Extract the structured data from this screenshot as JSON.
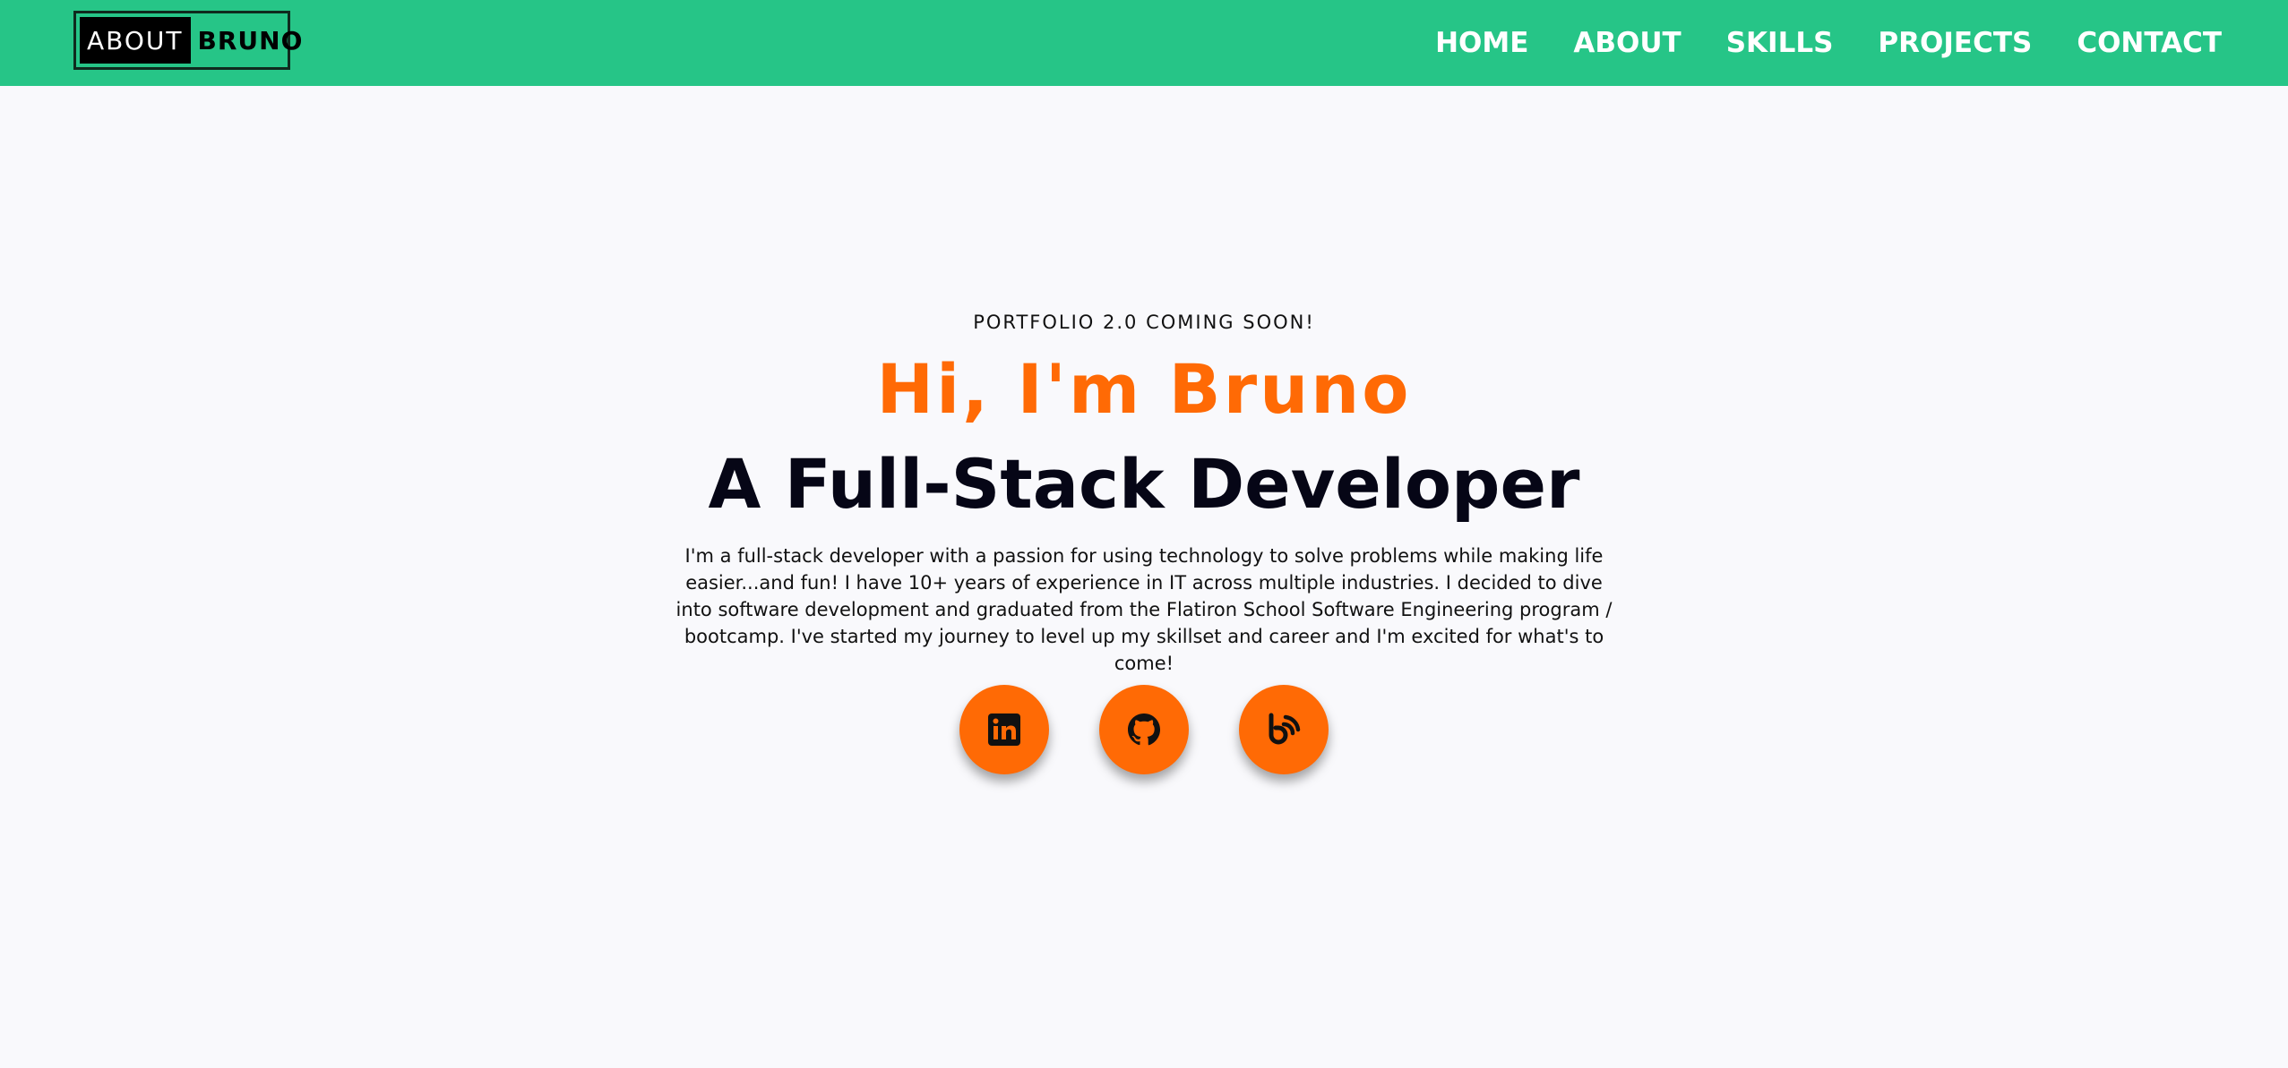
{
  "navbar": {
    "logo": {
      "about_text": "ABOUT",
      "name_text": "BRUNO"
    },
    "links": [
      {
        "label": "HOME"
      },
      {
        "label": "ABOUT"
      },
      {
        "label": "SKILLS"
      },
      {
        "label": "PROJECTS"
      },
      {
        "label": "CONTACT"
      }
    ]
  },
  "hero": {
    "tagline": "PORTFOLIO 2.0 COMING SOON!",
    "greeting": "Hi, I'm Bruno",
    "role": "A Full-Stack Developer",
    "bio": "I'm a full-stack developer with a passion for using technology to solve problems while making life easier...and fun! I have 10+ years of experience in IT across multiple industries. I decided to dive into software development and graduated from the Flatiron School Software Engineering program / bootcamp. I've started my journey to level up my skillset and career and I'm excited for what's to come!"
  },
  "socials": [
    {
      "icon": "linkedin-icon"
    },
    {
      "icon": "github-icon"
    },
    {
      "icon": "blog-icon"
    }
  ],
  "colors": {
    "navbar_bg": "#26c587",
    "accent": "#ff6a05",
    "heading": "#060616",
    "page_bg": "#f9f9fc"
  }
}
